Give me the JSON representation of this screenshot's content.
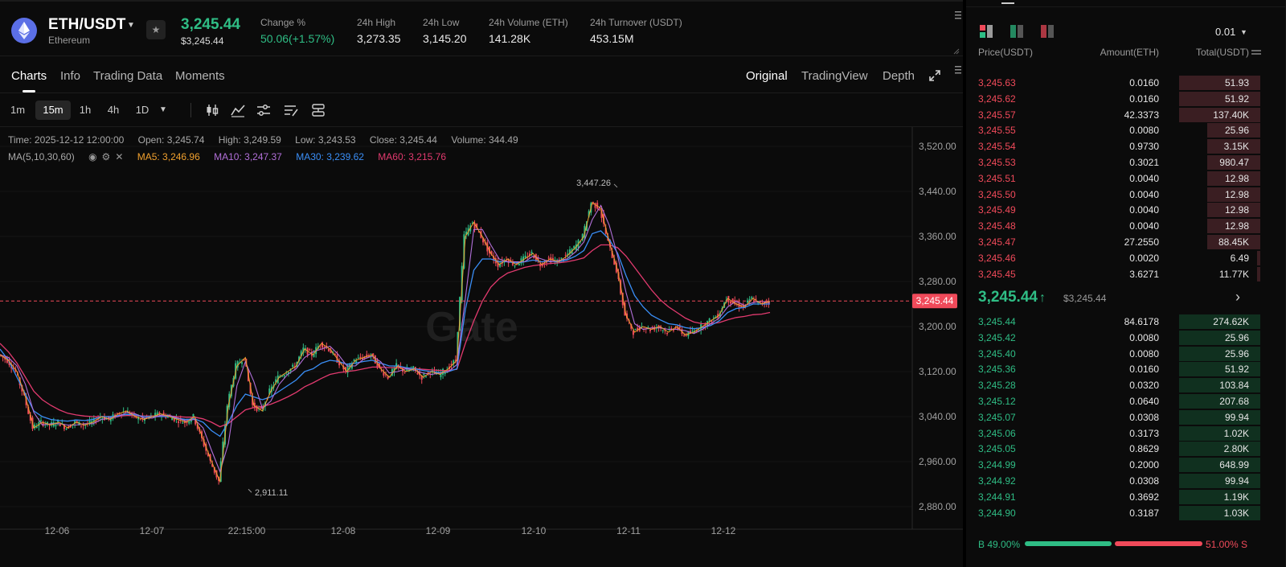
{
  "header": {
    "pair": "ETH/USDT",
    "pair_name": "Ethereum",
    "last_price": "3,245.44",
    "last_price_usd": "$3,245.44",
    "stats": [
      {
        "label": "Change %",
        "value": "50.06(+1.57%)",
        "positive": true
      },
      {
        "label": "24h High",
        "value": "3,273.35"
      },
      {
        "label": "24h Low",
        "value": "3,145.20"
      },
      {
        "label": "24h Volume (ETH)",
        "value": "141.28K"
      },
      {
        "label": "24h Turnover (USDT)",
        "value": "453.15M"
      }
    ]
  },
  "tabs": [
    "Charts",
    "Info",
    "Trading Data",
    "Moments"
  ],
  "view_tabs": [
    "Original",
    "TradingView",
    "Depth"
  ],
  "timeframes": [
    "1m",
    "15m",
    "1h",
    "4h",
    "1D"
  ],
  "active_timeframe": "15m",
  "chart_info": {
    "time": "Time: 2025-12-12 12:00:00",
    "open": "Open: 3,245.74",
    "high": "High: 3,249.59",
    "low": "Low: 3,243.53",
    "close": "Close: 3,245.44",
    "volume": "Volume: 344.49",
    "ma_label": "MA(5,10,30,60)",
    "ma5": "MA5: 3,246.96",
    "ma10": "MA10: 3,247.37",
    "ma30": "MA30: 3,239.62",
    "ma60": "MA60: 3,215.76"
  },
  "watermark": "Gate",
  "chart_data": {
    "type": "candlestick",
    "y_ticks": [
      "3,520.00",
      "3,440.00",
      "3,360.00",
      "3,280.00",
      "3,200.00",
      "3,120.00",
      "3,040.00",
      "2,960.00",
      "2,880.00"
    ],
    "ylim": [
      2860,
      3540
    ],
    "x_ticks": [
      "12-06",
      "12-07",
      "22:15:00",
      "12-08",
      "12-09",
      "12-10",
      "12-11",
      "12-12"
    ],
    "current_price": 3245.44,
    "current_price_label": "3,245.44",
    "high_marker": {
      "value": 3447.26,
      "label": "3,447.26"
    },
    "low_marker": {
      "value": 2911.11,
      "label": "2,911.11"
    },
    "close_path": [
      3150,
      3140,
      3120,
      3075,
      3020,
      3030,
      3025,
      3030,
      3020,
      3030,
      3025,
      3030,
      3040,
      3035,
      3045,
      3050,
      3040,
      3035,
      3040,
      3045,
      3040,
      3035,
      3030,
      3040,
      3000,
      2960,
      2925,
      3060,
      3130,
      3145,
      3060,
      3050,
      3085,
      3110,
      3120,
      3130,
      3160,
      3150,
      3170,
      3160,
      3140,
      3120,
      3140,
      3145,
      3150,
      3125,
      3110,
      3130,
      3120,
      3125,
      3110,
      3120,
      3115,
      3125,
      3140,
      3360,
      3385,
      3360,
      3330,
      3310,
      3320,
      3310,
      3320,
      3330,
      3310,
      3320,
      3315,
      3325,
      3340,
      3360,
      3420,
      3410,
      3350,
      3300,
      3220,
      3190,
      3200,
      3195,
      3200,
      3190,
      3200,
      3185,
      3190,
      3200,
      3210,
      3220,
      3250,
      3240,
      3235,
      3250,
      3240,
      3245
    ],
    "ma30_path": [
      3160,
      3140,
      3110,
      3080,
      3050,
      3040,
      3035,
      3033,
      3032,
      3034,
      3033,
      3035,
      3040,
      3040,
      3042,
      3044,
      3043,
      3040,
      3040,
      3040,
      3040,
      3037,
      3035,
      3036,
      3030,
      3015,
      3005,
      3030,
      3060,
      3080,
      3075,
      3070,
      3075,
      3085,
      3095,
      3105,
      3120,
      3125,
      3135,
      3140,
      3138,
      3133,
      3135,
      3138,
      3140,
      3135,
      3130,
      3130,
      3127,
      3125,
      3122,
      3120,
      3118,
      3120,
      3125,
      3230,
      3300,
      3320,
      3320,
      3315,
      3315,
      3313,
      3315,
      3318,
      3315,
      3316,
      3315,
      3318,
      3325,
      3335,
      3365,
      3370,
      3355,
      3330,
      3290,
      3255,
      3235,
      3220,
      3212,
      3205,
      3203,
      3198,
      3196,
      3198,
      3202,
      3210,
      3225,
      3232,
      3234,
      3240,
      3240,
      3240
    ],
    "ma60_path": [
      3170,
      3155,
      3135,
      3110,
      3085,
      3070,
      3060,
      3052,
      3046,
      3043,
      3041,
      3040,
      3040,
      3040,
      3041,
      3042,
      3042,
      3041,
      3041,
      3041,
      3041,
      3040,
      3039,
      3039,
      3036,
      3030,
      3022,
      3028,
      3040,
      3052,
      3056,
      3058,
      3062,
      3068,
      3075,
      3083,
      3093,
      3100,
      3108,
      3115,
      3118,
      3120,
      3122,
      3125,
      3128,
      3128,
      3127,
      3127,
      3126,
      3125,
      3124,
      3123,
      3122,
      3122,
      3124,
      3170,
      3210,
      3245,
      3270,
      3285,
      3295,
      3300,
      3305,
      3308,
      3310,
      3312,
      3313,
      3315,
      3318,
      3322,
      3335,
      3345,
      3345,
      3340,
      3325,
      3305,
      3285,
      3265,
      3248,
      3235,
      3225,
      3215,
      3208,
      3205,
      3205,
      3207,
      3212,
      3216,
      3218,
      3221,
      3222,
      3225
    ]
  },
  "orderbook": {
    "precision": "0.01",
    "headers": [
      "Price(USDT)",
      "Amount(ETH)",
      "Total(USDT)"
    ],
    "asks": [
      {
        "price": "3,245.63",
        "amount": "0.0160",
        "total": "51.93",
        "depth": 0.86
      },
      {
        "price": "3,245.62",
        "amount": "0.0160",
        "total": "51.92",
        "depth": 0.86
      },
      {
        "price": "3,245.57",
        "amount": "42.3373",
        "total": "137.40K",
        "depth": 0.86
      },
      {
        "price": "3,245.55",
        "amount": "0.0080",
        "total": "25.96",
        "depth": 0.56
      },
      {
        "price": "3,245.54",
        "amount": "0.9730",
        "total": "3.15K",
        "depth": 0.56
      },
      {
        "price": "3,245.53",
        "amount": "0.3021",
        "total": "980.47",
        "depth": 0.56
      },
      {
        "price": "3,245.51",
        "amount": "0.0040",
        "total": "12.98",
        "depth": 0.56
      },
      {
        "price": "3,245.50",
        "amount": "0.0040",
        "total": "12.98",
        "depth": 0.56
      },
      {
        "price": "3,245.49",
        "amount": "0.0040",
        "total": "12.98",
        "depth": 0.56
      },
      {
        "price": "3,245.48",
        "amount": "0.0040",
        "total": "12.98",
        "depth": 0.56
      },
      {
        "price": "3,245.47",
        "amount": "27.2550",
        "total": "88.45K",
        "depth": 0.56
      },
      {
        "price": "3,245.46",
        "amount": "0.0020",
        "total": "6.49",
        "depth": 0.03
      },
      {
        "price": "3,245.45",
        "amount": "3.6271",
        "total": "11.77K",
        "depth": 0.03
      }
    ],
    "mid_price": "3,245.44",
    "mid_price_usd": "$3,245.44",
    "bids": [
      {
        "price": "3,245.44",
        "amount": "84.6178",
        "total": "274.62K",
        "depth": 0.86
      },
      {
        "price": "3,245.42",
        "amount": "0.0080",
        "total": "25.96",
        "depth": 0.86
      },
      {
        "price": "3,245.40",
        "amount": "0.0080",
        "total": "25.96",
        "depth": 0.86
      },
      {
        "price": "3,245.36",
        "amount": "0.0160",
        "total": "51.92",
        "depth": 0.86
      },
      {
        "price": "3,245.28",
        "amount": "0.0320",
        "total": "103.84",
        "depth": 0.86
      },
      {
        "price": "3,245.12",
        "amount": "0.0640",
        "total": "207.68",
        "depth": 0.86
      },
      {
        "price": "3,245.07",
        "amount": "0.0308",
        "total": "99.94",
        "depth": 0.86
      },
      {
        "price": "3,245.06",
        "amount": "0.3173",
        "total": "1.02K",
        "depth": 0.86
      },
      {
        "price": "3,245.05",
        "amount": "0.8629",
        "total": "2.80K",
        "depth": 0.86
      },
      {
        "price": "3,244.99",
        "amount": "0.2000",
        "total": "648.99",
        "depth": 0.86
      },
      {
        "price": "3,244.92",
        "amount": "0.0308",
        "total": "99.94",
        "depth": 0.86
      },
      {
        "price": "3,244.91",
        "amount": "0.3692",
        "total": "1.19K",
        "depth": 0.86
      },
      {
        "price": "3,244.90",
        "amount": "0.3187",
        "total": "1.03K",
        "depth": 0.86
      }
    ],
    "buy_ratio": "B 49.00%",
    "sell_ratio": "51.00% S",
    "buy_fraction": 0.49
  },
  "colors": {
    "up": "#2fbd85",
    "down": "#f04a5a",
    "ma5": "#f0a02e",
    "ma10": "#b16fd8",
    "ma30": "#3a8ef6",
    "ma60": "#e23a6f"
  }
}
